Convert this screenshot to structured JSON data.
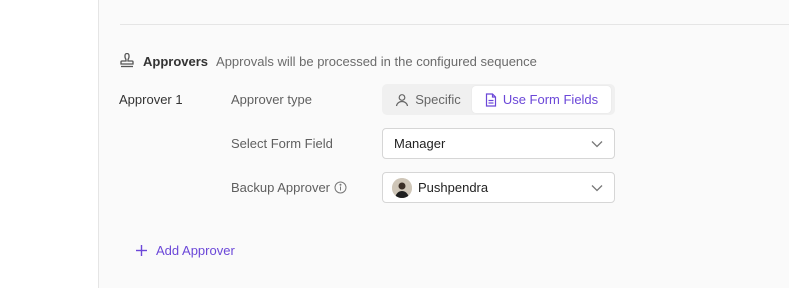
{
  "section": {
    "title": "Approvers",
    "description": "Approvals will be processed in the configured sequence"
  },
  "approver": {
    "label": "Approver 1",
    "type_label": "Approver type",
    "type_options": {
      "specific": "Specific",
      "form_fields": "Use Form Fields"
    },
    "selected_type": "Use Form Fields",
    "form_field_label": "Select Form Field",
    "form_field_value": "Manager",
    "backup_label": "Backup Approver",
    "backup_value": "Pushpendra"
  },
  "actions": {
    "add_approver": "Add Approver"
  },
  "colors": {
    "accent": "#6b47d8",
    "border": "#d6d6d6",
    "background": "#fafafa"
  },
  "icons": {
    "section": "stamp-icon",
    "specific": "user-icon",
    "form_fields": "document-icon",
    "info": "info-icon",
    "dropdown": "chevron-down-icon",
    "add": "plus-icon"
  }
}
